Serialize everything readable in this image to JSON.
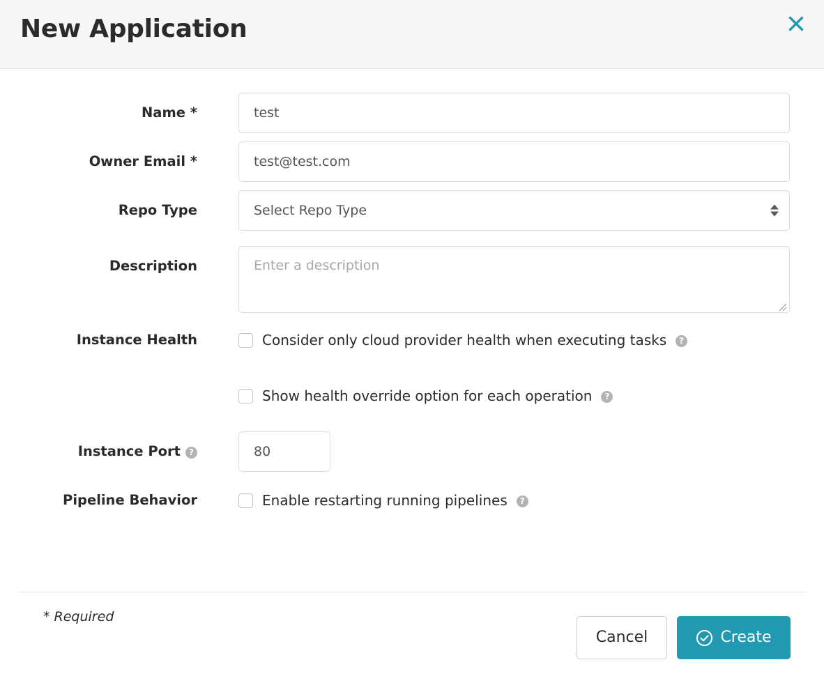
{
  "dialog": {
    "title": "New Application",
    "close_icon": "close-icon"
  },
  "form": {
    "name": {
      "label": "Name *",
      "value": "test",
      "placeholder": ""
    },
    "owner_email": {
      "label": "Owner Email *",
      "value": "test@test.com",
      "placeholder": ""
    },
    "repo_type": {
      "label": "Repo Type",
      "selected": "Select Repo Type"
    },
    "description": {
      "label": "Description",
      "value": "",
      "placeholder": "Enter a description"
    },
    "instance_health": {
      "label": "Instance Health",
      "option1": {
        "text": "Consider only cloud provider health when executing tasks",
        "checked": false,
        "help": "?"
      },
      "option2": {
        "text": "Show health override option for each operation",
        "checked": false,
        "help": "?"
      }
    },
    "instance_port": {
      "label": "Instance Port",
      "help": "?",
      "value": "80"
    },
    "pipeline_behavior": {
      "label": "Pipeline Behavior",
      "option1": {
        "text": "Enable restarting running pipelines",
        "checked": false,
        "help": "?"
      }
    },
    "required_note": "* Required"
  },
  "footer": {
    "cancel_label": "Cancel",
    "create_label": "Create",
    "create_icon": "check-circle-icon"
  },
  "colors": {
    "accent": "#2199b0",
    "header_bg": "#f7f7f7",
    "text": "#2b2b2b",
    "border": "#dcdcdc",
    "help_icon": "#b3b3b3"
  }
}
